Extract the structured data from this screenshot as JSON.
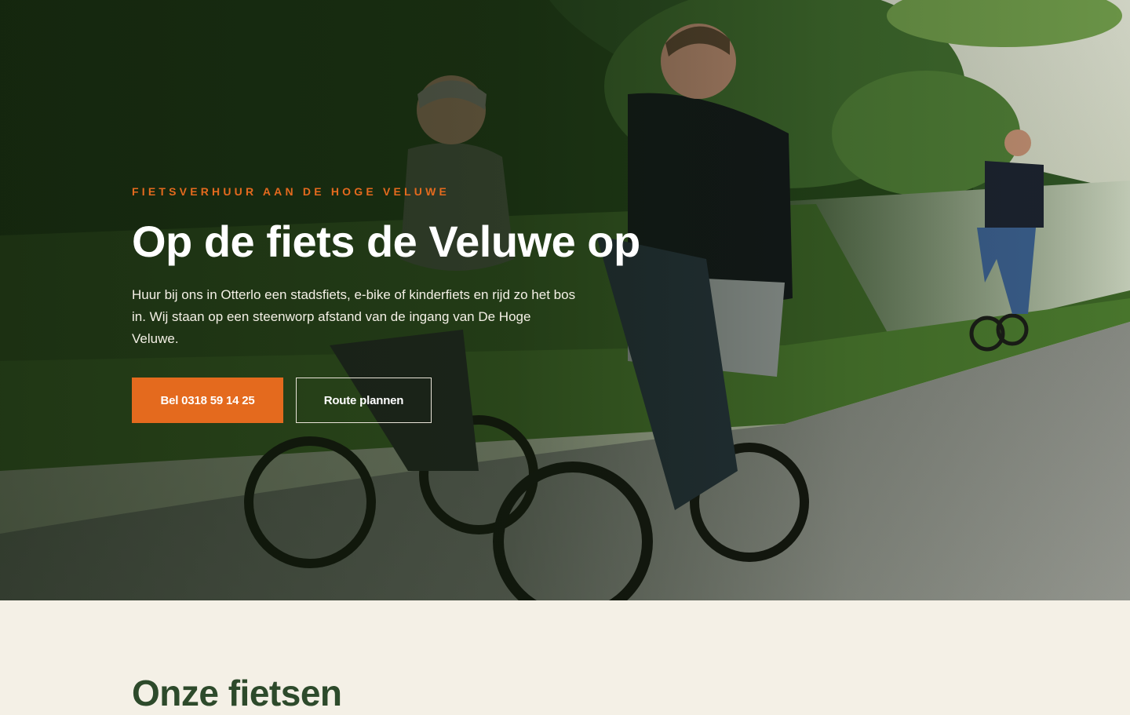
{
  "hero": {
    "eyebrow": "FIETSVERHUUR AAN DE HOGE VELUWE",
    "title": "Op de fiets de Veluwe op",
    "text": "Huur bij ons in Otterlo een stadsfiets, e-bike of kinderfiets en rijd zo het bos in. Wij staan op een steenworp afstand van de ingang van De Hoge Veluwe.",
    "primary_button": "Bel 0318 59 14 25",
    "secondary_button": "Route plannen",
    "image_alt": "photo-cyclists-on-forest-path"
  },
  "section": {
    "title": "Onze fietsen"
  },
  "colors": {
    "accent": "#e46a1e",
    "section_heading": "#2d4a2b",
    "page_background": "#f4f0e6"
  }
}
